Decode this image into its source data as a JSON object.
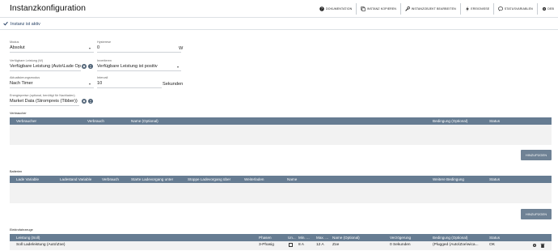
{
  "app": {
    "title": "Instanzkonfiguration"
  },
  "toolbar": {
    "documentation": "DOKUMENTATION",
    "copy_instance": "INSTANZ KOPIEREN",
    "edit_object": "INSTANZOBJEKT BEARBEITEN",
    "events": "EREIGNISSE",
    "status_variables": "STATUSVARIABLEN",
    "more": "DEB"
  },
  "status": {
    "text": "Instanz ist aktiv"
  },
  "form": {
    "modus": {
      "label": "Modus",
      "value": "Absolut"
    },
    "hysterese": {
      "label": "Hysterese",
      "value": "0",
      "unit": "W"
    },
    "leistung": {
      "label": "Verfügbare Leistung (W)",
      "value": "Verfügbare Leistung (Auto\\Lade Op"
    },
    "invertieren": {
      "label": "Invertieren",
      "value": "Verfügbare Leistung ist positiv"
    },
    "aktualisierung": {
      "label": "Aktualisierungsmodus",
      "value": "Nach Timer"
    },
    "intervall": {
      "label": "Intervall",
      "value": "10",
      "unit": "Sekunden"
    },
    "energiepreis": {
      "label": "Energiepreise (optional, benötigt für Nachladen)",
      "value": "Market Data (Strompreis (Tibber))"
    }
  },
  "verbraucher": {
    "section": "Verbraucher",
    "headers": [
      "Verbraucher",
      "Verbrauch",
      "Name (Optional)",
      "Bedingung (Optional)",
      "Status"
    ],
    "add_label": "HINZUFÜGEN"
  },
  "batterien": {
    "section": "Batterien",
    "headers": [
      "Lade Variable",
      "Ladestand Variable",
      "Verbrauch",
      "Starte Ladevorgang unter",
      "Stoppe Ladevorgang über",
      "Weiterladen",
      "Name",
      "Weitere Bedingung",
      "Status"
    ],
    "add_label": "HINZUFÜGEN"
  },
  "fahrzeuge": {
    "section": "Elektrofahrzeuge",
    "headers": [
      "Leistung (Soll)",
      "Phasen",
      "Un...",
      "Min. ...",
      "Max. ...",
      "Name (Optional)",
      "Verzögerung",
      "Bedingung (Optional)",
      "Status"
    ],
    "rows": [
      {
        "leistung": "Soll Ladeleistung (Auto\\Zoe)",
        "phasen": "3-Phasig",
        "min": "8 A",
        "max": "12 A",
        "name": "Zoe",
        "verzoegerung": "0 Sekunden",
        "bedingung": "(Plugged (Auto\\Zoe\\wica...",
        "status": "OK"
      }
    ]
  },
  "colors": {
    "header": "#667c92",
    "button": "#6f8295",
    "accent": "#1e3a5f"
  }
}
